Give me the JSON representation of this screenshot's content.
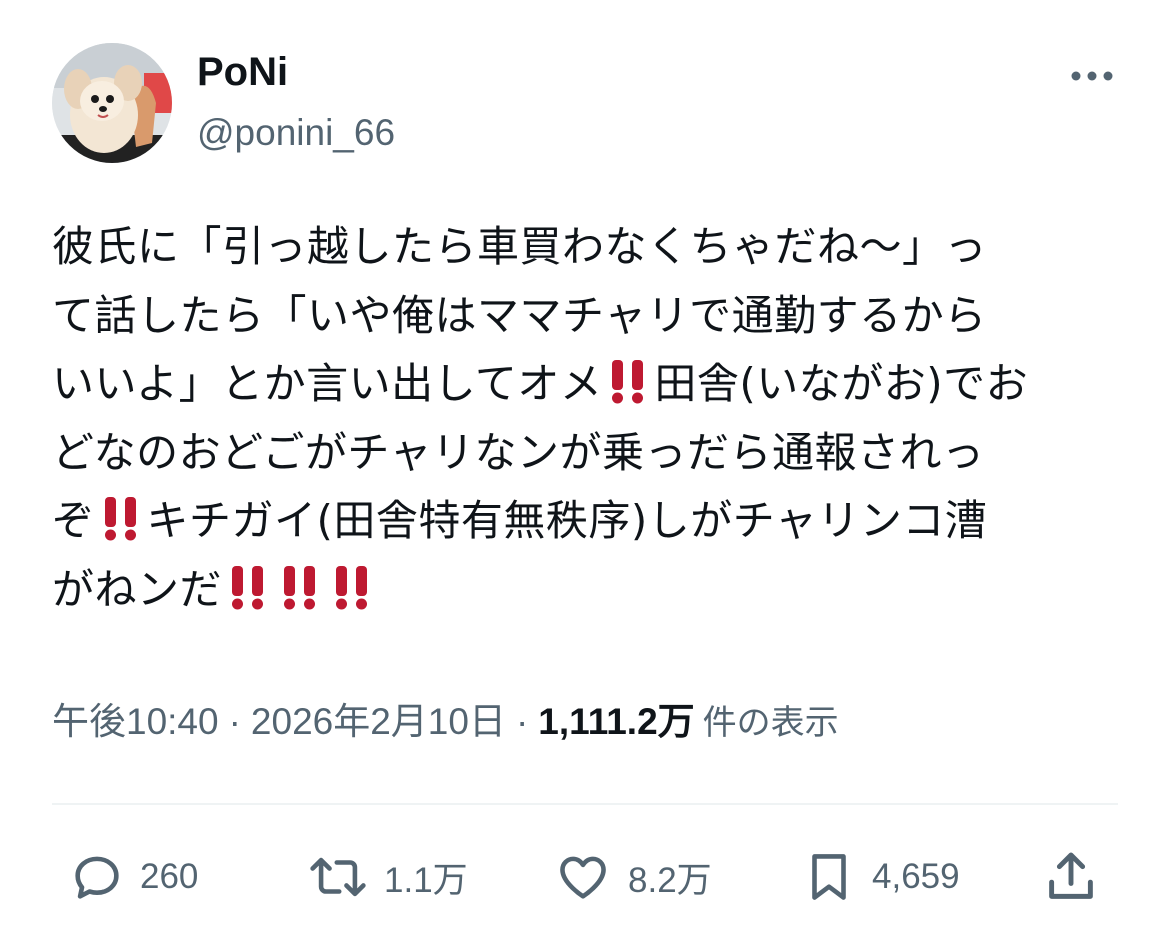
{
  "author": {
    "display_name": "PoNi",
    "handle": "@ponini_66",
    "avatar_icon": "dog-avatar"
  },
  "tweet": {
    "lines": [
      "彼氏に「引っ越したら車買わなくちゃだね〜」っ",
      "て話したら「いや俺はママチャリで通勤するから",
      "いいよ」とか言い出してオメ",
      "田舎(いながお)でお",
      "どなのおどごがチャリなンが乗っだら通報されっ",
      "ぞ",
      "キチガイ(田舎特有無秩序)しがチャリンコ漕",
      "がねンだ"
    ],
    "emoji_icon": "double-exclamation-icon",
    "emoji_color": "#be1931"
  },
  "meta": {
    "time": "午後10:40",
    "separator": "·",
    "date": "2026年2月10日",
    "views_count": "1,111.2万",
    "views_label": "件の表示"
  },
  "actions": {
    "replies": "260",
    "reposts": "1.1万",
    "likes": "8.2万",
    "bookmarks": "4,659"
  },
  "colors": {
    "text": "#0f1419",
    "secondary": "#536471",
    "divider": "#eff3f4"
  }
}
